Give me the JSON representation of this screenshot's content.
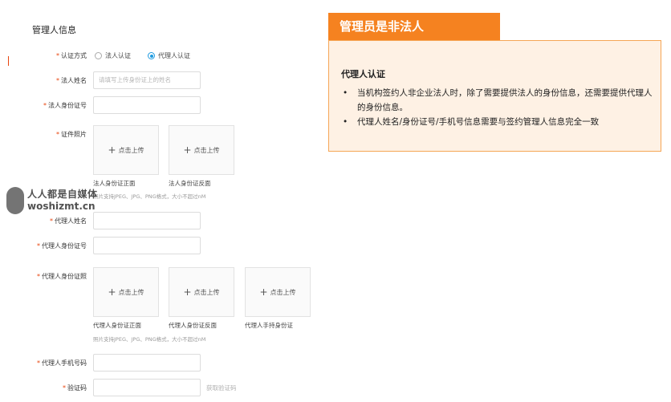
{
  "form": {
    "section_title": "管理人信息",
    "auth_method": {
      "label": "认证方式",
      "option1": "法人认证",
      "option2": "代理人认证",
      "selected": "代理人认证"
    },
    "legal_name": {
      "label": "法人姓名",
      "placeholder": "请填写上传身份证上的姓名"
    },
    "legal_id": {
      "label": "法人身份证号"
    },
    "id_photo": {
      "label": "证件照片",
      "upload_text": "点击上传",
      "cap_front": "法人身份证正面",
      "cap_back": "法人身份证反面",
      "note": "照片支持JPEG、JPG、PNG格式，大小不超过nM"
    },
    "agent_name": {
      "label": "代理人姓名"
    },
    "agent_id": {
      "label": "代理人身份证号"
    },
    "agent_photo": {
      "label": "代理人身份证照",
      "upload_text": "点击上传",
      "cap_front": "代理人身份证正面",
      "cap_back": "代理人身份证反面",
      "cap_hold": "代理人手持身份证",
      "note": "照片支持JPEG、JPG、PNG格式，大小不超过nM"
    },
    "agent_phone": {
      "label": "代理人手机号码"
    },
    "verify_code": {
      "label": "验证码",
      "get_code": "获取验证码"
    }
  },
  "watermark": {
    "line1": "人人都是自媒体",
    "line2": "woshizmt.cn"
  },
  "panel": {
    "title": "管理员是非法人",
    "heading": "代理人认证",
    "items": [
      "当机构签约人非企业法人时，除了需要提供法人的身份信息，还需要提供代理人的身份信息。",
      "代理人姓名/身份证号/手机号信息需要与签约管理人信息完全一致"
    ]
  },
  "colors": {
    "accent": "#f58220",
    "panel_bg": "#fef1e4",
    "required": "#e8450e",
    "radio": "#1f9be0"
  }
}
